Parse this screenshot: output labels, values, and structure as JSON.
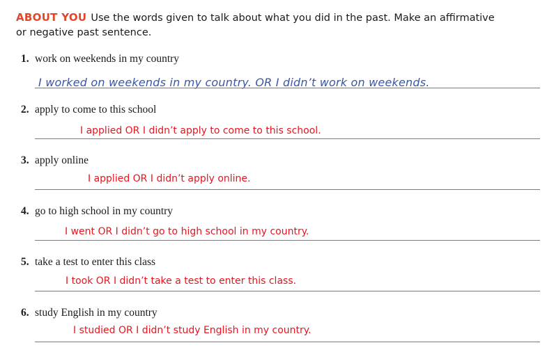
{
  "header": {
    "tag": "ABOUT YOU",
    "instruction": "Use the words given to talk about what you did in the past. Make an affirmative or negative past sentence."
  },
  "items": [
    {
      "num": "1.",
      "prompt": "work on weekends in my country",
      "answer": "I worked on weekends in my country. OR I didn’t work on weekends."
    },
    {
      "num": "2.",
      "prompt": "apply to come to this school",
      "answer": "I applied OR I didn’t apply to come to this school."
    },
    {
      "num": "3.",
      "prompt": "apply online",
      "answer": "I applied OR I didn’t apply online."
    },
    {
      "num": "4.",
      "prompt": "go to high school in my country",
      "answer": "I went OR I didn’t go to high school in my country."
    },
    {
      "num": "5.",
      "prompt": "take a test to enter this class",
      "answer": "I took OR I didn’t take a test to enter this class."
    },
    {
      "num": "6.",
      "prompt": "study English in my country",
      "answer": "I studied OR I didn’t study English in my country."
    }
  ],
  "colors": {
    "tag": "#e0462a",
    "answer": "#e8141e",
    "handwriting": "#3a56a8"
  }
}
